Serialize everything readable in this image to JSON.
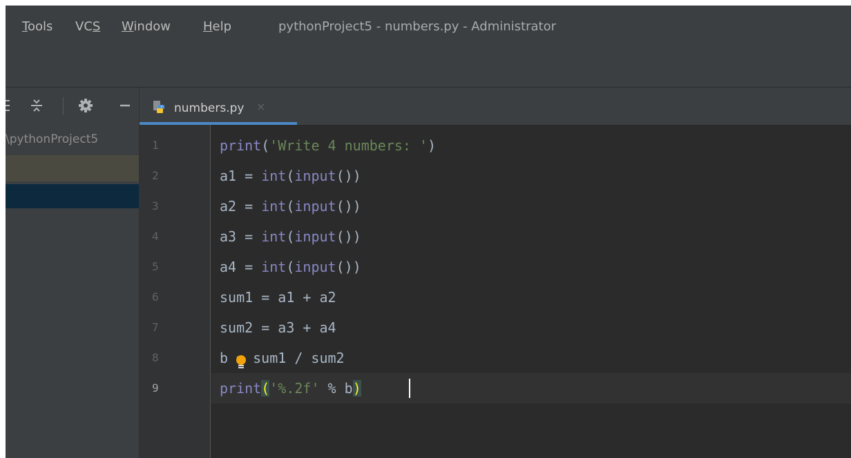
{
  "menubar": {
    "items": [
      {
        "mn": "T",
        "rest": "ools"
      },
      {
        "pre": "VC",
        "mn": "S"
      },
      {
        "mn": "W",
        "rest": "indow"
      },
      {
        "mn": "H",
        "rest": "elp"
      }
    ],
    "title": "pythonProject5 - numbers.py - Administrator"
  },
  "project_panel": {
    "root_label": "\\pythonProject5"
  },
  "editor_tab": {
    "label": "numbers.py",
    "close_glyph": "×"
  },
  "editor": {
    "line_numbers": [
      "1",
      "2",
      "3",
      "4",
      "5",
      "6",
      "7",
      "8",
      "9"
    ],
    "current_line": "9",
    "code": {
      "l1": {
        "fn": "print",
        "open": "(",
        "str": "'Write 4 numbers: '",
        "close": ")"
      },
      "l2": {
        "lhs": "a1 = ",
        "fn1": "int",
        "p1": "(",
        "fn2": "input",
        "p2": "())"
      },
      "l3": {
        "lhs": "a2 = ",
        "fn1": "int",
        "p1": "(",
        "fn2": "input",
        "p2": "())"
      },
      "l4": {
        "lhs": "a3 = ",
        "fn1": "int",
        "p1": "(",
        "fn2": "input",
        "p2": "())"
      },
      "l5": {
        "lhs": "a4 = ",
        "fn1": "int",
        "p1": "(",
        "fn2": "input",
        "p2": "())"
      },
      "l6": {
        "text": "sum1 = a1 + a2"
      },
      "l7": {
        "text": "sum2 = a3 + a4"
      },
      "l8": {
        "a": "b",
        "b": "= sum1 / sum2"
      },
      "l9": {
        "fn": "print",
        "open": "(",
        "str": "'%.2f'",
        "mid": " % b",
        "close": ")"
      }
    }
  },
  "colors": {
    "background": "#2b2b2b",
    "builtin": "#8888c6",
    "string": "#6a8759",
    "text": "#a9b7c6",
    "tab_underline": "#4a88c7",
    "bracket_highlight": "#ffef28"
  }
}
